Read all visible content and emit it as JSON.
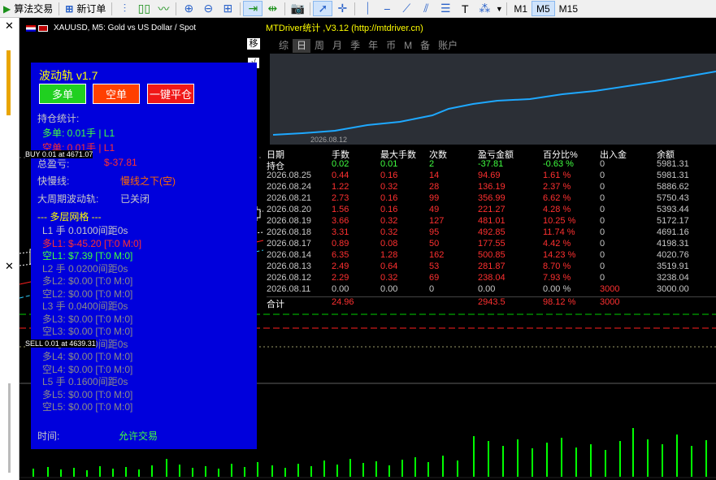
{
  "toolbar": {
    "algo_trading": "算法交易",
    "new_order": "新订单",
    "timeframes": [
      "M1",
      "M5",
      "M15"
    ],
    "selected_timeframe": "M5"
  },
  "chart": {
    "symbol_title": "XAUUSD, M5:  Gold vs US Dollar / Spot",
    "buy_line_label": "BUY 0.01 at 4671.07",
    "sell_line_label": "SELL 0.01 at 4639.31",
    "drag_label": "移",
    "check_label": "√"
  },
  "ea": {
    "title": "波动轨 v1.7",
    "buttons": {
      "long": "多单",
      "short": "空单",
      "close_all": "一键平仓"
    },
    "position_stats_label": "持仓统计:",
    "long_stat": "多单: 0.01手 | L1",
    "short_stat": "空单: 0.01手 | L1",
    "total_profit_label": "总盈亏:",
    "total_profit_value": "$-37.81",
    "fast_slow_label": "快慢线:",
    "fast_slow_value": "慢线之下(空)",
    "big_cycle_label": "大周期波动轨:",
    "big_cycle_value": "已关闭",
    "grid_header": "--- 多层网格 ---",
    "grid_lines": [
      "L1 手 0.0100间距0s",
      "多L1: $-45.20 [T:0 M:0]",
      "空L1: $7.39 [T:0 M:0]",
      "L2 手 0.0200间距0s",
      "多L2: $0.00 [T:0 M:0]",
      "空L2: $0.00 [T:0 M:0]",
      "L3 手 0.0400间距0s",
      "多L3: $0.00 [T:0 M:0]",
      "空L3: $0.00 [T:0 M:0]",
      "L4 手 0.0800间距0s",
      "多L4: $0.00 [T:0 M:0]",
      "空L4: $0.00 [T:0 M:0]",
      "L5 手 0.1600间距0s",
      "多L5: $0.00 [T:0 M:0]",
      "空L5: $0.00 [T:0 M:0]"
    ],
    "time_label": "时间:",
    "time_value": "允许交易"
  },
  "mtd": {
    "header": "MTDriver统计 ,V3.12 (http://mtdriver.cn)",
    "tabs": [
      "综",
      "日",
      "周",
      "月",
      "季",
      "年",
      "币",
      "M",
      "备",
      "账户"
    ],
    "selected_tab": "日",
    "plot_date": "2026.08.12",
    "columns": [
      "日期",
      "手数",
      "最大手数",
      "次数",
      "盈亏金额",
      "百分比%",
      "出入金",
      "余额"
    ],
    "holding": [
      "持仓",
      "0.02",
      "0.01",
      "2",
      "-37.81",
      "-0.63 %",
      "0",
      "5981.31"
    ],
    "rows": [
      [
        "2026.08.25",
        "0.44",
        "0.16",
        "14",
        "94.69",
        "1.61 %",
        "0",
        "5981.31"
      ],
      [
        "2026.08.24",
        "1.22",
        "0.32",
        "28",
        "136.19",
        "2.37 %",
        "0",
        "5886.62"
      ],
      [
        "2026.08.21",
        "2.73",
        "0.16",
        "99",
        "356.99",
        "6.62 %",
        "0",
        "5750.43"
      ],
      [
        "2026.08.20",
        "1.56",
        "0.16",
        "49",
        "221.27",
        "4.28 %",
        "0",
        "5393.44"
      ],
      [
        "2026.08.19",
        "3.66",
        "0.32",
        "127",
        "481.01",
        "10.25 %",
        "0",
        "5172.17"
      ],
      [
        "2026.08.18",
        "3.31",
        "0.32",
        "95",
        "492.85",
        "11.74 %",
        "0",
        "4691.16"
      ],
      [
        "2026.08.17",
        "0.89",
        "0.08",
        "50",
        "177.55",
        "4.42 %",
        "0",
        "4198.31"
      ],
      [
        "2026.08.14",
        "6.35",
        "1.28",
        "162",
        "500.85",
        "14.23 %",
        "0",
        "4020.76"
      ],
      [
        "2026.08.13",
        "2.49",
        "0.64",
        "53",
        "281.87",
        "8.70 %",
        "0",
        "3519.91"
      ],
      [
        "2026.08.12",
        "2.29",
        "0.32",
        "69",
        "238.04",
        "7.93 %",
        "0",
        "3238.04"
      ],
      [
        "2026.08.11",
        "0.00",
        "0.00",
        "0",
        "0.00",
        "0.00 %",
        "3000",
        "3000.00"
      ]
    ],
    "total": [
      "合计",
      "24.96",
      "",
      "",
      "2943.5",
      "98.12 %",
      "3000",
      ""
    ]
  }
}
